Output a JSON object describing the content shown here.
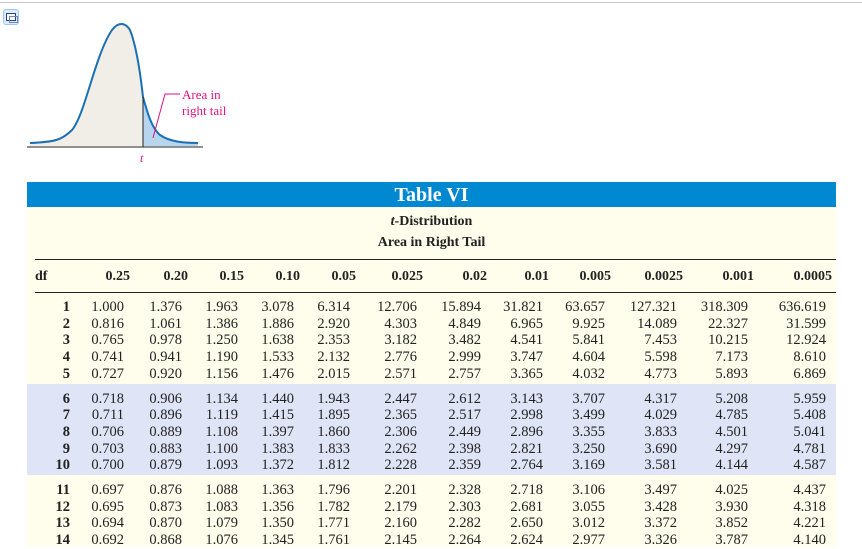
{
  "figure": {
    "callout_label": "Area in right tail",
    "callout_line1": "Area in",
    "callout_line2": "right tail",
    "axis_label": "t"
  },
  "table": {
    "title": "Table VI",
    "subtitle_italic": "t",
    "subtitle_rest": "-Distribution",
    "caption": "Area in Right Tail",
    "columns": [
      "df",
      "0.25",
      "0.20",
      "0.15",
      "0.10",
      "0.05",
      "0.025",
      "0.02",
      "0.01",
      "0.005",
      "0.0025",
      "0.001",
      "0.0005"
    ],
    "rows": [
      [
        "1",
        "1.000",
        "1.376",
        "1.963",
        "3.078",
        "6.314",
        "12.706",
        "15.894",
        "31.821",
        "63.657",
        "127.321",
        "318.309",
        "636.619"
      ],
      [
        "2",
        "0.816",
        "1.061",
        "1.386",
        "1.886",
        "2.920",
        "4.303",
        "4.849",
        "6.965",
        "9.925",
        "14.089",
        "22.327",
        "31.599"
      ],
      [
        "3",
        "0.765",
        "0.978",
        "1.250",
        "1.638",
        "2.353",
        "3.182",
        "3.482",
        "4.541",
        "5.841",
        "7.453",
        "10.215",
        "12.924"
      ],
      [
        "4",
        "0.741",
        "0.941",
        "1.190",
        "1.533",
        "2.132",
        "2.776",
        "2.999",
        "3.747",
        "4.604",
        "5.598",
        "7.173",
        "8.610"
      ],
      [
        "5",
        "0.727",
        "0.920",
        "1.156",
        "1.476",
        "2.015",
        "2.571",
        "2.757",
        "3.365",
        "4.032",
        "4.773",
        "5.893",
        "6.869"
      ],
      [
        "6",
        "0.718",
        "0.906",
        "1.134",
        "1.440",
        "1.943",
        "2.447",
        "2.612",
        "3.143",
        "3.707",
        "4.317",
        "5.208",
        "5.959"
      ],
      [
        "7",
        "0.711",
        "0.896",
        "1.119",
        "1.415",
        "1.895",
        "2.365",
        "2.517",
        "2.998",
        "3.499",
        "4.029",
        "4.785",
        "5.408"
      ],
      [
        "8",
        "0.706",
        "0.889",
        "1.108",
        "1.397",
        "1.860",
        "2.306",
        "2.449",
        "2.896",
        "3.355",
        "3.833",
        "4.501",
        "5.041"
      ],
      [
        "9",
        "0.703",
        "0.883",
        "1.100",
        "1.383",
        "1.833",
        "2.262",
        "2.398",
        "2.821",
        "3.250",
        "3.690",
        "4.297",
        "4.781"
      ],
      [
        "10",
        "0.700",
        "0.879",
        "1.093",
        "1.372",
        "1.812",
        "2.228",
        "2.359",
        "2.764",
        "3.169",
        "3.581",
        "4.144",
        "4.587"
      ],
      [
        "11",
        "0.697",
        "0.876",
        "1.088",
        "1.363",
        "1.796",
        "2.201",
        "2.328",
        "2.718",
        "3.106",
        "3.497",
        "4.025",
        "4.437"
      ],
      [
        "12",
        "0.695",
        "0.873",
        "1.083",
        "1.356",
        "1.782",
        "2.179",
        "2.303",
        "2.681",
        "3.055",
        "3.428",
        "3.930",
        "4.318"
      ],
      [
        "13",
        "0.694",
        "0.870",
        "1.079",
        "1.350",
        "1.771",
        "2.160",
        "2.282",
        "2.650",
        "3.012",
        "3.372",
        "3.852",
        "4.221"
      ],
      [
        "14",
        "0.692",
        "0.868",
        "1.076",
        "1.345",
        "1.761",
        "2.145",
        "2.264",
        "2.624",
        "2.977",
        "3.326",
        "3.787",
        "4.140"
      ]
    ]
  },
  "colors": {
    "banner": "#0088d1",
    "panel": "#fffdeb",
    "band": "#dfe5f7",
    "callout": "#e0117f",
    "curve": "#1a6fb5",
    "tail": "#b7d6ee"
  }
}
